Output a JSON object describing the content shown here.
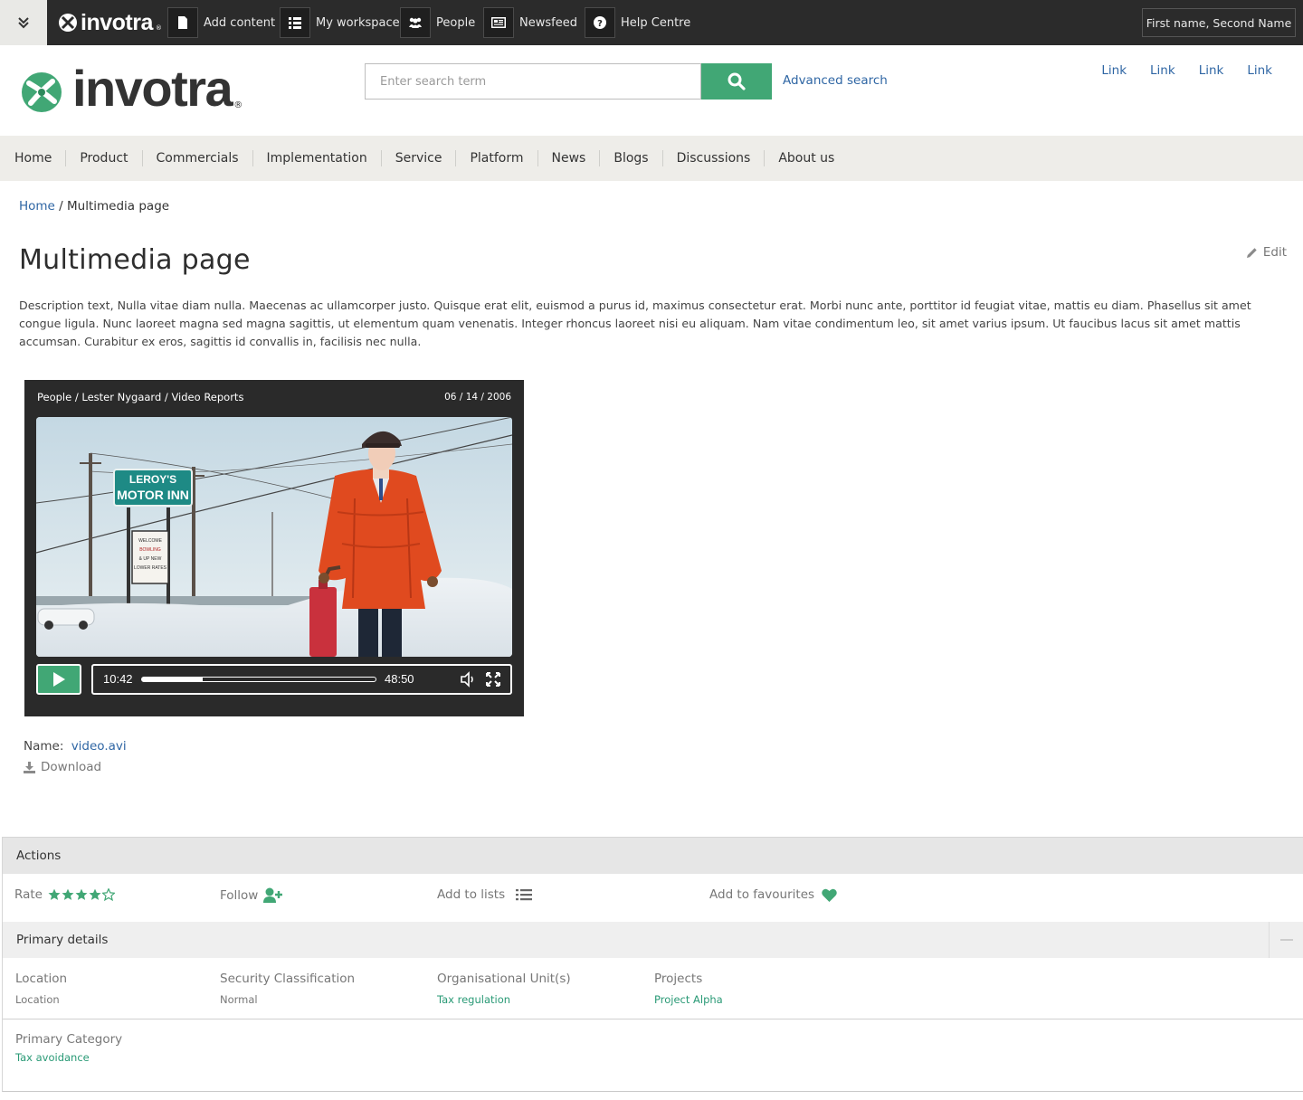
{
  "topbar": {
    "brand": "invotra",
    "brand_mark": "®",
    "items": [
      {
        "label": "Add content",
        "icon": "file-icon"
      },
      {
        "label": "My workspace",
        "icon": "list-icon"
      },
      {
        "label": "People",
        "icon": "people-icon"
      },
      {
        "label": "Newsfeed",
        "icon": "newspaper-icon"
      },
      {
        "label": "Help Centre",
        "icon": "question-icon"
      }
    ],
    "user": "First name, Second Name"
  },
  "header": {
    "logo_text": "invotra",
    "logo_mark": "®",
    "search_placeholder": "Enter search term",
    "advanced_search": "Advanced search",
    "links": [
      "Link",
      "Link",
      "Link",
      "Link"
    ]
  },
  "nav": [
    "Home",
    "Product",
    "Commercials",
    "Implementation",
    "Service",
    "Platform",
    "News",
    "Blogs",
    "Discussions",
    "About us"
  ],
  "breadcrumb": {
    "home": "Home",
    "sep": " / ",
    "current": "Multimedia page"
  },
  "page": {
    "title": "Multimedia page",
    "edit_label": "Edit",
    "description": "Description text, Nulla vitae diam nulla. Maecenas ac ullamcorper justo. Quisque erat elit, euismod a purus id, maximus consectetur erat. Morbi nunc ante, porttitor id feugiat vitae, mattis eu diam. Phasellus sit amet congue ligula. Nunc laoreet magna sed magna sagittis, ut elementum quam venenatis. Integer rhoncus laoreet nisi eu aliquam. Nam vitae condimentum leo, sit amet varius ipsum. Ut faucibus lacus sit amet mattis accumsan. Curabitur ex eros, sagittis id convallis in, facilisis nec nulla."
  },
  "video": {
    "path": "People / Lester Nygaard / Video Reports",
    "date": "06 / 14 / 2006",
    "current_time": "10:42",
    "duration": "48:50",
    "progress_fraction": 0.26,
    "sign_line1": "LEROY'S",
    "sign_line2": "MOTOR INN",
    "sign_board": [
      "WELCOME",
      "BOWLING",
      "& UP NEW",
      "LOWER RATES"
    ]
  },
  "file": {
    "name_label": "Name:",
    "name": "video.avi",
    "download_label": "Download"
  },
  "actions": {
    "heading": "Actions",
    "rate_label": "Rate",
    "rating": 4,
    "rating_max": 5,
    "follow_label": "Follow",
    "lists_label": "Add to lists",
    "favourites_label": "Add to favourites"
  },
  "primary": {
    "heading": "Primary details",
    "fields": [
      {
        "label": "Location",
        "value": "Location",
        "link": false
      },
      {
        "label": "Security Classification",
        "value": "Normal",
        "link": false
      },
      {
        "label": "Organisational Unit(s)",
        "value": "Tax regulation",
        "link": true
      },
      {
        "label": "Projects",
        "value": "Project Alpha",
        "link": true
      }
    ],
    "category_label": "Primary Category",
    "category_value": "Tax avoidance"
  },
  "colors": {
    "accent": "#41a775",
    "link": "#2f66a4",
    "topbar": "#2b2b2b",
    "nav_bg": "#eeede9"
  }
}
